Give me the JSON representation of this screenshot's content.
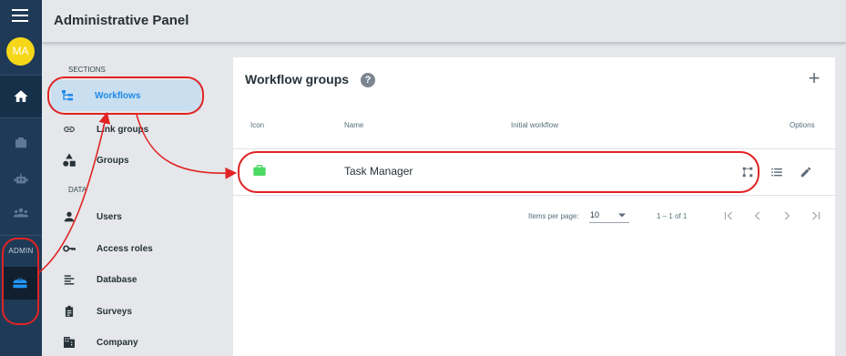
{
  "rail": {
    "avatar_initials": "MA",
    "admin_label": "ADMIN"
  },
  "header": {
    "title": "Administrative Panel"
  },
  "sidebar": {
    "sections_label": "SECTIONS",
    "data_label": "DATA",
    "items": [
      {
        "label": "Workflows",
        "icon": "workflow-tree-icon"
      },
      {
        "label": "Link groups",
        "icon": "link-icon"
      },
      {
        "label": "Groups",
        "icon": "shapes-icon"
      },
      {
        "label": "Users",
        "icon": "person-icon"
      },
      {
        "label": "Access roles",
        "icon": "key-icon"
      },
      {
        "label": "Database",
        "icon": "list-icon"
      },
      {
        "label": "Surveys",
        "icon": "clipboard-icon"
      },
      {
        "label": "Company",
        "icon": "building-icon"
      }
    ]
  },
  "card": {
    "title": "Workflow groups",
    "add_symbol": "+",
    "help_symbol": "?",
    "columns": {
      "icon": "Icon",
      "name": "Name",
      "initial": "Initial workflow",
      "options": "Options"
    },
    "rows": [
      {
        "name": "Task Manager",
        "icon_color": "#4cd964"
      }
    ],
    "pager": {
      "items_per_page_label": "Items per page:",
      "items_per_page_value": "10",
      "range": "1 – 1 of 1"
    }
  },
  "colors": {
    "rail": "#1f3a56",
    "accent": "#1e88e5",
    "annotation": "#e02424"
  }
}
